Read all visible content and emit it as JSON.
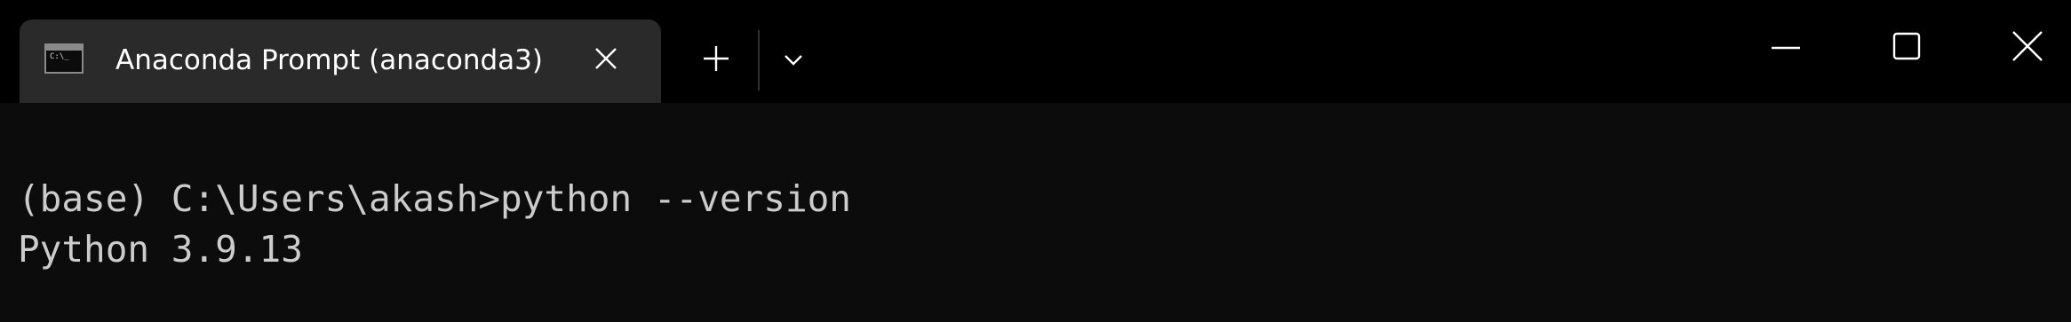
{
  "tab": {
    "title": "Anaconda Prompt (anaconda3)",
    "icon": "terminal-icon",
    "icon_glyph": "C:\\_"
  },
  "titlebar": {
    "new_tab_icon": "plus-icon",
    "dropdown_icon": "chevron-down-icon",
    "minimize_icon": "minimize-icon",
    "maximize_icon": "maximize-icon",
    "close_icon": "close-icon"
  },
  "terminal": {
    "lines": [
      "(base) C:\\Users\\akash>python --version",
      "Python 3.9.13"
    ]
  },
  "colors": {
    "titlebar_bg": "#000000",
    "tab_bg": "#2a2a2a",
    "terminal_bg": "#0c0c0c",
    "terminal_text": "#cccccc"
  }
}
